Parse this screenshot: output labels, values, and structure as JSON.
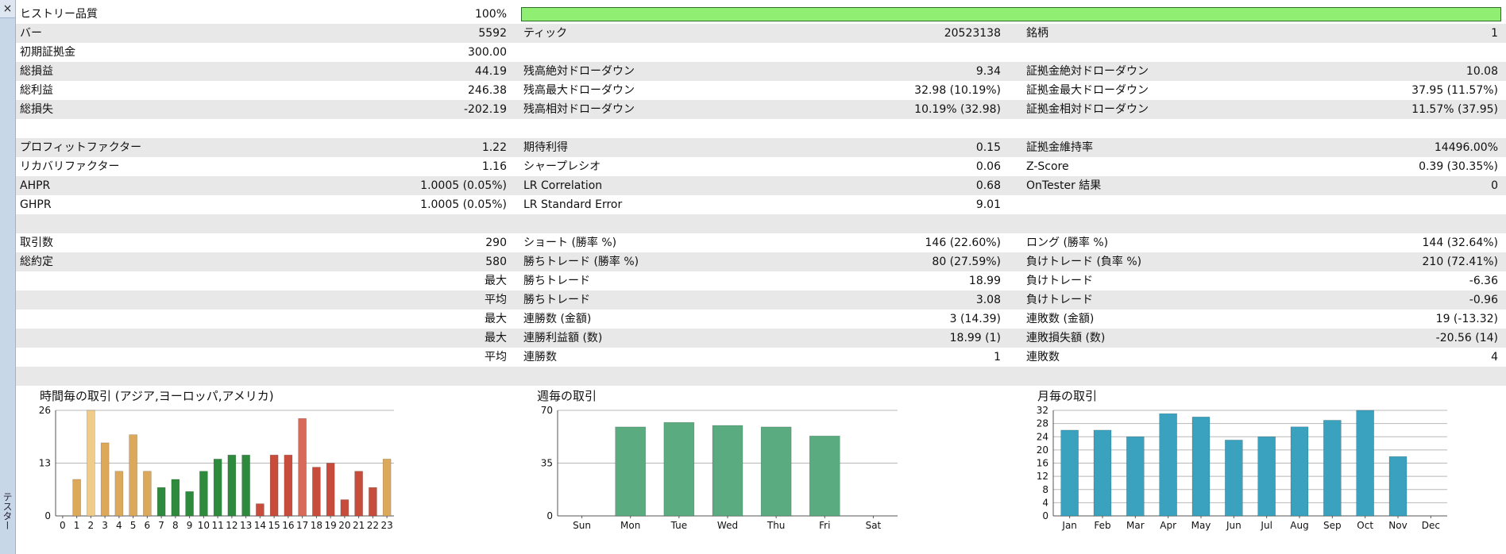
{
  "panel": {
    "close_icon": "×",
    "side_label": "テスター"
  },
  "report": {
    "quality": {
      "label": "ヒストリー品質",
      "value": "100%",
      "level": 1.0,
      "bar_color": "#90ee72"
    },
    "rows": [
      {
        "c1": "バー",
        "v1": "5592",
        "c2": "ティック",
        "v2": "20523138",
        "c3": "銘柄",
        "v3": "1"
      },
      {
        "c1": "初期証拠金",
        "v1": "300.00",
        "c2": "",
        "v2": "",
        "c3": "",
        "v3": ""
      },
      {
        "c1": "総損益",
        "v1": "44.19",
        "c2": "残高絶対ドローダウン",
        "v2": "9.34",
        "c3": "証拠金絶対ドローダウン",
        "v3": "10.08"
      },
      {
        "c1": "総利益",
        "v1": "246.38",
        "c2": "残高最大ドローダウン",
        "v2": "32.98 (10.19%)",
        "c3": "証拠金最大ドローダウン",
        "v3": "37.95 (11.57%)"
      },
      {
        "c1": "総損失",
        "v1": "-202.19",
        "c2": "残高相対ドローダウン",
        "v2": "10.19% (32.98)",
        "c3": "証拠金相対ドローダウン",
        "v3": "11.57% (37.95)"
      },
      {
        "c1": "",
        "v1": "",
        "c2": "",
        "v2": "",
        "c3": "",
        "v3": ""
      },
      {
        "c1": "プロフィットファクター",
        "v1": "1.22",
        "c2": "期待利得",
        "v2": "0.15",
        "c3": "証拠金維持率",
        "v3": "14496.00%"
      },
      {
        "c1": "リカバリファクター",
        "v1": "1.16",
        "c2": "シャープレシオ",
        "v2": "0.06",
        "c3": "Z-Score",
        "v3": "0.39 (30.35%)"
      },
      {
        "c1": "AHPR",
        "v1": "1.0005 (0.05%)",
        "c2": "LR Correlation",
        "v2": "0.68",
        "c3": "OnTester 結果",
        "v3": "0"
      },
      {
        "c1": "GHPR",
        "v1": "1.0005 (0.05%)",
        "c2": "LR Standard Error",
        "v2": "9.01",
        "c3": "",
        "v3": ""
      },
      {
        "c1": "",
        "v1": "",
        "c2": "",
        "v2": "",
        "c3": "",
        "v3": ""
      },
      {
        "c1": "取引数",
        "v1": "290",
        "c2": "ショート (勝率 %)",
        "v2": "146 (22.60%)",
        "c3": "ロング (勝率 %)",
        "v3": "144 (32.64%)"
      },
      {
        "c1": "総約定",
        "v1": "580",
        "c2": "勝ちトレード (勝率 %)",
        "v2": "80 (27.59%)",
        "c3": "負けトレード (負率 %)",
        "v3": "210 (72.41%)"
      },
      {
        "c1": "",
        "v1": "最大",
        "c2": "勝ちトレード",
        "v2": "18.99",
        "c3": "負けトレード",
        "v3": "-6.36"
      },
      {
        "c1": "",
        "v1": "平均",
        "c2": "勝ちトレード",
        "v2": "3.08",
        "c3": "負けトレード",
        "v3": "-0.96"
      },
      {
        "c1": "",
        "v1": "最大",
        "c2": "連勝数 (金額)",
        "v2": "3 (14.39)",
        "c3": "連敗数 (金額)",
        "v3": "19 (-13.32)"
      },
      {
        "c1": "",
        "v1": "最大",
        "c2": "連勝利益額 (数)",
        "v2": "18.99 (1)",
        "c3": "連敗損失額 (数)",
        "v3": "-20.56 (14)"
      },
      {
        "c1": "",
        "v1": "平均",
        "c2": "連勝数",
        "v2": "1",
        "c3": "連敗数",
        "v3": "4"
      },
      {
        "c1": "",
        "v1": "",
        "c2": "",
        "v2": "",
        "c3": "",
        "v3": ""
      }
    ]
  },
  "chart_data": [
    {
      "type": "bar",
      "title": "時間毎の取引 (アジア,ヨーロッパ,アメリカ)",
      "categories": [
        "0",
        "1",
        "2",
        "3",
        "4",
        "5",
        "6",
        "7",
        "8",
        "9",
        "10",
        "11",
        "12",
        "13",
        "14",
        "15",
        "16",
        "17",
        "18",
        "19",
        "20",
        "21",
        "22",
        "23"
      ],
      "values": [
        0,
        9,
        26,
        18,
        11,
        20,
        11,
        7,
        9,
        6,
        11,
        14,
        15,
        15,
        3,
        15,
        15,
        24,
        12,
        13,
        4,
        11,
        7,
        14
      ],
      "bar_colors": [
        "#dca85a",
        "#dca85a",
        "#f0cc8a",
        "#dca85a",
        "#dca85a",
        "#dca85a",
        "#dca85a",
        "#2e8b3e",
        "#2e8b3e",
        "#2e8b3e",
        "#2e8b3e",
        "#2e8b3e",
        "#2e8b3e",
        "#2e8b3e",
        "#c84c3c",
        "#c84c3c",
        "#c84c3c",
        "#d86a5a",
        "#c84c3c",
        "#c84c3c",
        "#c84c3c",
        "#c84c3c",
        "#c84c3c",
        "#dca85a"
      ],
      "ylim": [
        0,
        26
      ],
      "yticks": [
        0,
        13,
        26
      ],
      "grid": true
    },
    {
      "type": "bar",
      "title": "週毎の取引",
      "categories": [
        "Sun",
        "Mon",
        "Tue",
        "Wed",
        "Thu",
        "Fri",
        "Sat"
      ],
      "values": [
        0,
        59,
        62,
        60,
        59,
        53,
        0
      ],
      "bar_color": "#5aab7f",
      "ylim": [
        0,
        70
      ],
      "yticks": [
        0,
        35,
        70
      ],
      "grid": true
    },
    {
      "type": "bar",
      "title": "月毎の取引",
      "categories": [
        "Jan",
        "Feb",
        "Mar",
        "Apr",
        "May",
        "Jun",
        "Jul",
        "Aug",
        "Sep",
        "Oct",
        "Nov",
        "Dec"
      ],
      "values": [
        26,
        26,
        24,
        31,
        30,
        23,
        24,
        27,
        29,
        32,
        18,
        0
      ],
      "bar_color": "#3aa2bf",
      "ylim": [
        0,
        32
      ],
      "yticks": [
        0,
        4,
        8,
        12,
        16,
        20,
        24,
        28,
        32
      ],
      "grid": true
    }
  ]
}
